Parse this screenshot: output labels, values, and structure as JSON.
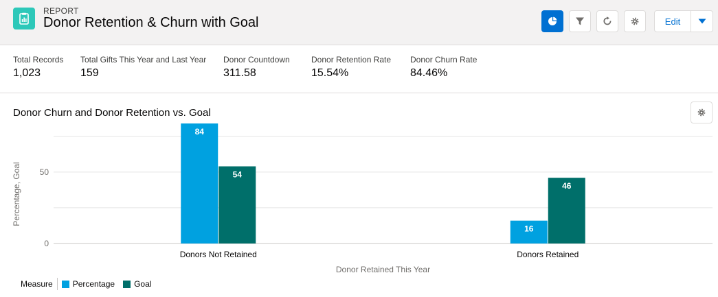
{
  "header": {
    "eyebrow": "REPORT",
    "title": "Donor Retention & Churn with Goal",
    "edit_label": "Edit",
    "icons": [
      "chart-icon",
      "filter-icon",
      "refresh-icon",
      "gear-icon",
      "chevron-down-icon"
    ]
  },
  "summary": [
    {
      "label": "Total Records",
      "value": "1,023"
    },
    {
      "label": "Total Gifts This Year and Last Year",
      "value": "159"
    },
    {
      "label": "Donor Countdown",
      "value": "311.58"
    },
    {
      "label": "Donor Retention Rate",
      "value": "15.54%"
    },
    {
      "label": "Donor Churn Rate",
      "value": "84.46%"
    }
  ],
  "chart": {
    "title": "Donor Churn and Donor Retention vs. Goal",
    "legend_title": "Measure"
  },
  "chart_data": {
    "type": "bar",
    "categories": [
      "Donors Not Retained",
      "Donors Retained"
    ],
    "series": [
      {
        "name": "Percentage",
        "values": [
          84,
          16
        ],
        "color": "#00a1e0"
      },
      {
        "name": "Goal",
        "values": [
          54,
          46
        ],
        "color": "#006f6a"
      }
    ],
    "xlabel": "Donor Retained This Year",
    "ylabel": "Percentage, Goal",
    "yticks": [
      0,
      50
    ],
    "ylim": [
      0,
      84
    ],
    "grid": true,
    "legend_position": "bottom-left"
  }
}
